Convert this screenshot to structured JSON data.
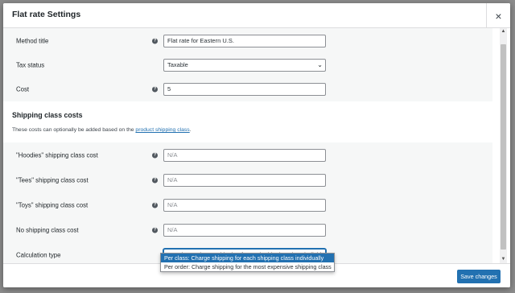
{
  "modal": {
    "title": "Flat rate Settings",
    "close_icon": "×",
    "save_label": "Save changes"
  },
  "general": {
    "method_title_label": "Method title",
    "method_title_value": "Flat rate for Eastern U.S.",
    "tax_status_label": "Tax status",
    "tax_status_value": "Taxable",
    "cost_label": "Cost",
    "cost_value": "5"
  },
  "shipping_classes": {
    "heading": "Shipping class costs",
    "description_prefix": "These costs can optionally be added based on the ",
    "description_link": "product shipping class",
    "description_suffix": ".",
    "rows": [
      {
        "label": "\"Hoodies\" shipping class cost",
        "placeholder": "N/A"
      },
      {
        "label": "\"Tees\" shipping class cost",
        "placeholder": "N/A"
      },
      {
        "label": "\"Toys\" shipping class cost",
        "placeholder": "N/A"
      },
      {
        "label": "No shipping class cost",
        "placeholder": "N/A"
      }
    ],
    "calculation_type_label": "Calculation type",
    "calculation_type_value": "Per class: Charge shipping for each shipping class individually",
    "calculation_type_options": [
      "Per class: Charge shipping for each shipping class individually",
      "Per order: Charge shipping for the most expensive shipping class"
    ]
  },
  "icons": {
    "help": "?",
    "chevron": "⌄",
    "scroll_up": "▲",
    "scroll_down": "▼"
  },
  "colors": {
    "accent": "#2271b1",
    "section_bg": "#f6f7f7",
    "overlay": "#7a7a7a"
  }
}
